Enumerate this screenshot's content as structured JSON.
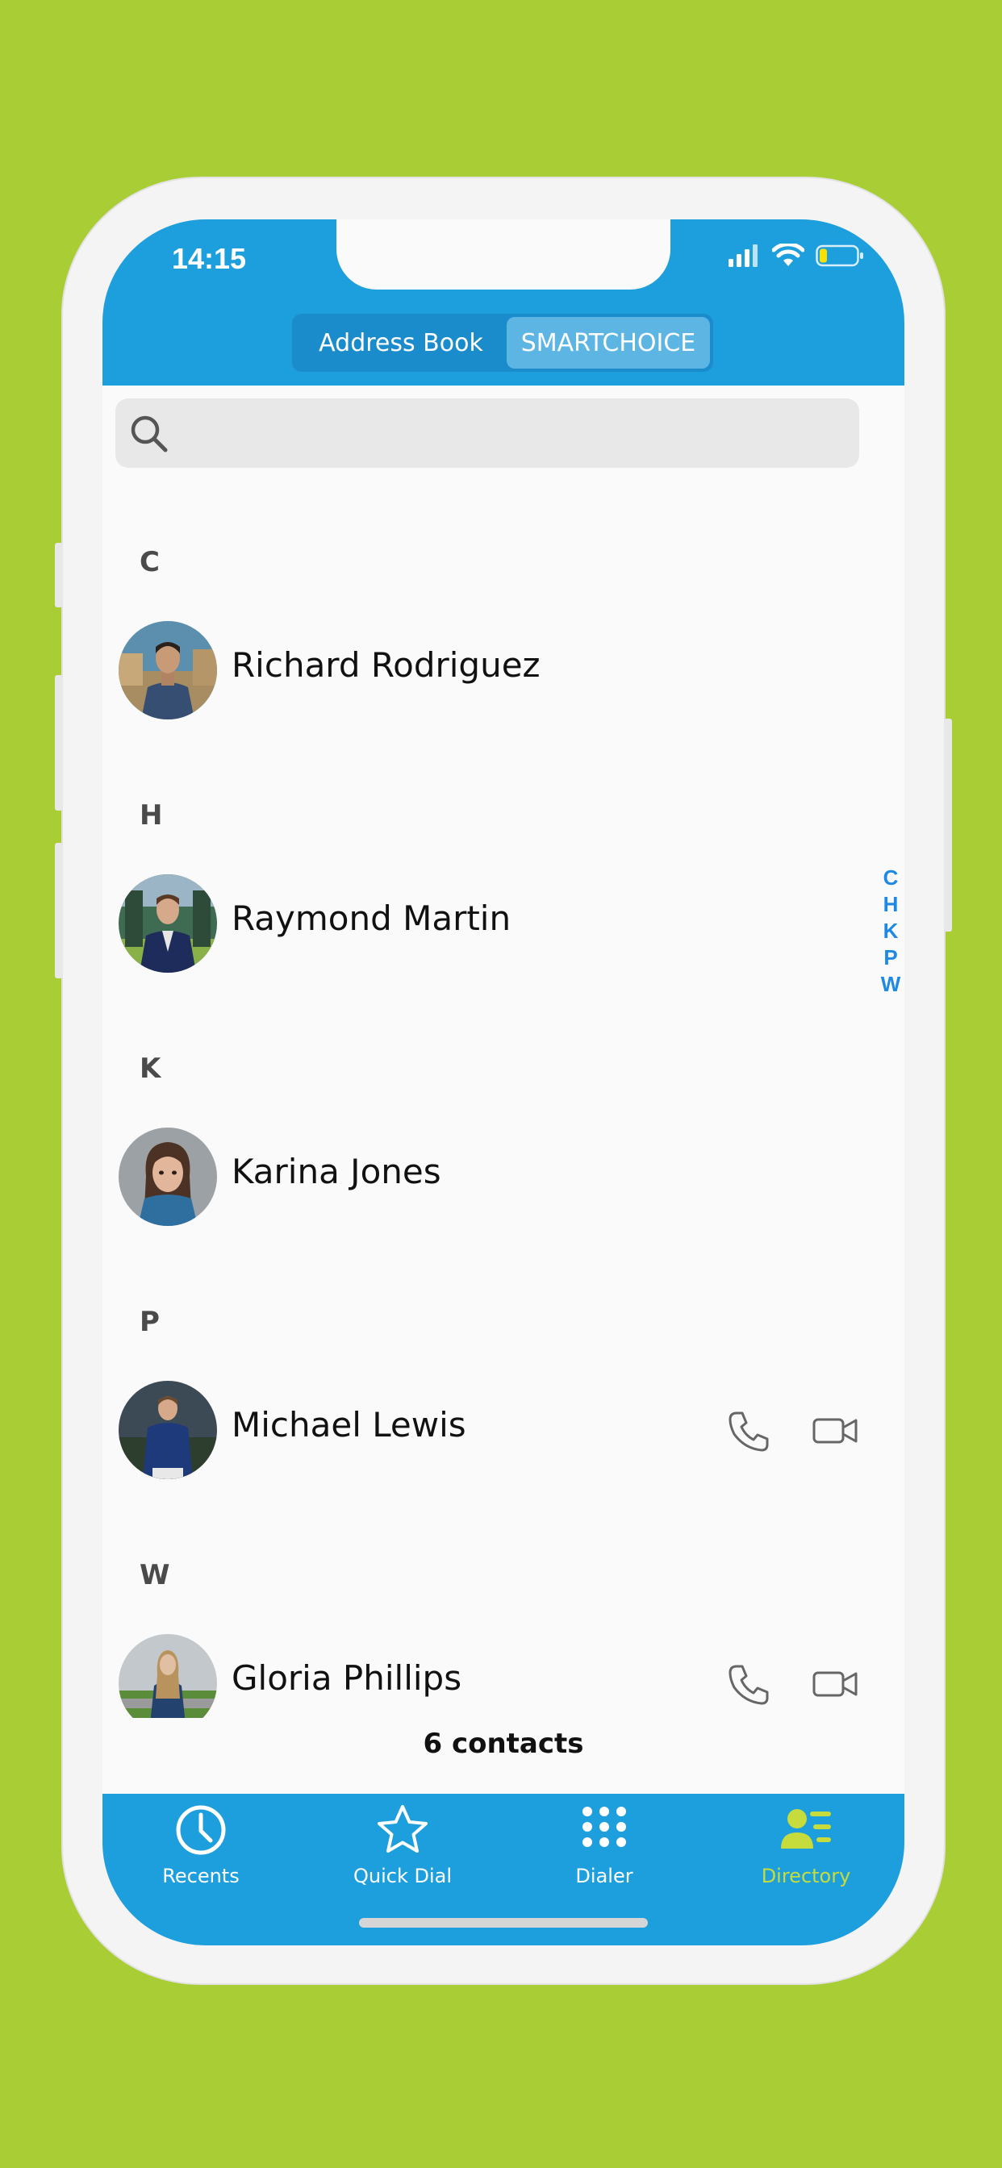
{
  "status_bar": {
    "time": "14:15"
  },
  "segment": {
    "options": [
      "Address Book",
      "SMARTCHOICE"
    ],
    "selected": "SMARTCHOICE"
  },
  "search": {
    "placeholder": "",
    "value": ""
  },
  "sections": [
    {
      "letter": "C",
      "contacts": [
        {
          "name": "Richard Rodriguez",
          "actions": false
        }
      ]
    },
    {
      "letter": "H",
      "contacts": [
        {
          "name": "Raymond Martin",
          "actions": false
        }
      ]
    },
    {
      "letter": "K",
      "contacts": [
        {
          "name": "Karina Jones",
          "actions": false
        }
      ]
    },
    {
      "letter": "P",
      "contacts": [
        {
          "name": "Michael Lewis",
          "actions": true
        }
      ]
    },
    {
      "letter": "W",
      "contacts": [
        {
          "name": "Gloria Phillips",
          "actions": true
        }
      ]
    }
  ],
  "alpha_index": [
    "C",
    "H",
    "K",
    "P",
    "W"
  ],
  "contact_count": "6 contacts",
  "tabs": [
    {
      "label": "Recents",
      "icon": "clock-icon"
    },
    {
      "label": "Quick Dial",
      "icon": "star-icon"
    },
    {
      "label": "Dialer",
      "icon": "dialpad-icon"
    },
    {
      "label": "Directory",
      "icon": "directory-icon",
      "active": true
    }
  ],
  "colors": {
    "background": "#a9cd35",
    "brand_blue": "#1d9fdd",
    "active_tab": "#c5dc3c",
    "index_blue": "#1e88e5"
  }
}
